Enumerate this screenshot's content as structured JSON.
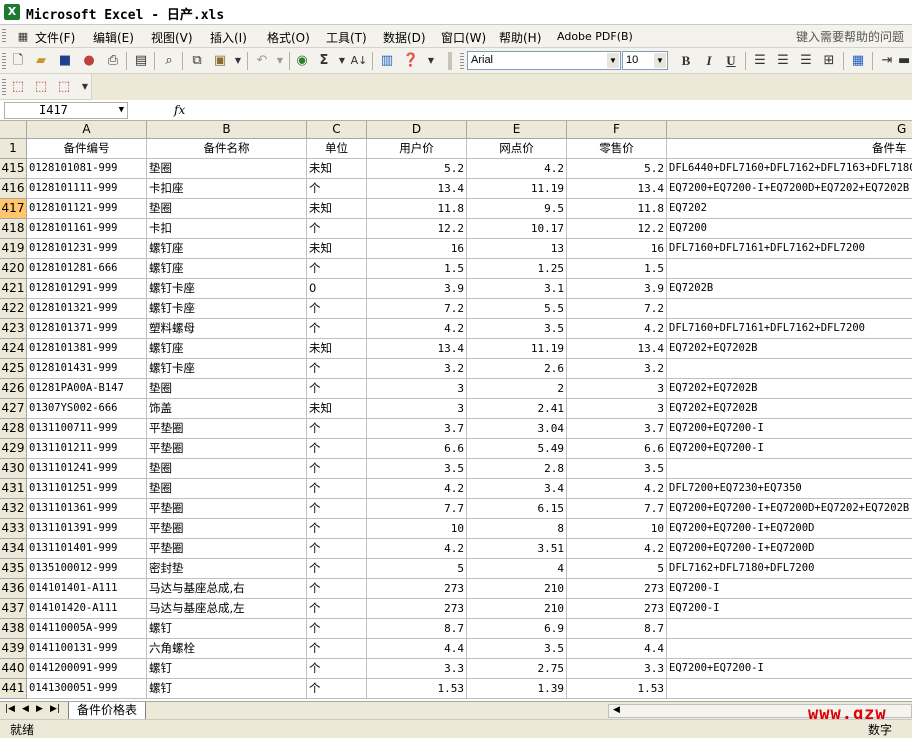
{
  "window": {
    "title": "Microsoft Excel - 日产.xls",
    "logo": "X"
  },
  "menu": {
    "items": [
      "文件(F)",
      "编辑(E)",
      "视图(V)",
      "插入(I)",
      "格式(O)",
      "工具(T)",
      "数据(D)",
      "窗口(W)",
      "帮助(H)",
      "Adobe PDF(B)"
    ],
    "help_placeholder": "键入需要帮助的问题"
  },
  "toolbar": {
    "font": "Arial",
    "font_size": "10",
    "undo_icon": "undo-icon",
    "bold": "B",
    "italic": "I",
    "underline": "U"
  },
  "formula_bar": {
    "name_box": "I417",
    "fx": "fx",
    "formula": ""
  },
  "colors": {
    "selected_row_header": "#ffc66b",
    "header_bg": "#ece9d8",
    "watermark": "#e00000"
  },
  "sheet": {
    "columns": [
      "A",
      "B",
      "C",
      "D",
      "E",
      "F",
      "G"
    ],
    "header_row_number": "1",
    "headers": [
      "备件编号",
      "备件名称",
      "单位",
      "用户价",
      "网点价",
      "零售价",
      "备件车"
    ],
    "selected_row": "417",
    "rows": [
      [
        "415",
        "0128101081-999",
        "垫圈",
        "未知",
        "5.2",
        "4.2",
        "5.2",
        "DFL6440+DFL7160+DFL7162+DFL7163+DFL7180+D"
      ],
      [
        "416",
        "0128101111-999",
        "卡扣座",
        "个",
        "13.4",
        "11.19",
        "13.4",
        "EQ7200+EQ7200-I+EQ7200D+EQ7202+EQ7202B"
      ],
      [
        "417",
        "0128101121-999",
        "垫圈",
        "未知",
        "11.8",
        "9.5",
        "11.8",
        "EQ7202"
      ],
      [
        "418",
        "0128101161-999",
        "卡扣",
        "个",
        "12.2",
        "10.17",
        "12.2",
        "EQ7200"
      ],
      [
        "419",
        "0128101231-999",
        "螺钉座",
        "未知",
        "16",
        "13",
        "16",
        "DFL7160+DFL7161+DFL7162+DFL7200"
      ],
      [
        "420",
        "0128101281-666",
        "螺钉座",
        "个",
        "1.5",
        "1.25",
        "1.5",
        ""
      ],
      [
        "421",
        "0128101291-999",
        "螺钉卡座",
        "0",
        "3.9",
        "3.1",
        "3.9",
        "EQ7202B"
      ],
      [
        "422",
        "0128101321-999",
        "螺钉卡座",
        "个",
        "7.2",
        "5.5",
        "7.2",
        ""
      ],
      [
        "423",
        "0128101371-999",
        "塑料螺母",
        "个",
        "4.2",
        "3.5",
        "4.2",
        "DFL7160+DFL7161+DFL7162+DFL7200"
      ],
      [
        "424",
        "0128101381-999",
        "螺钉座",
        "未知",
        "13.4",
        "11.19",
        "13.4",
        "EQ7202+EQ7202B"
      ],
      [
        "425",
        "0128101431-999",
        "螺钉卡座",
        "个",
        "3.2",
        "2.6",
        "3.2",
        ""
      ],
      [
        "426",
        "01281PA00A-B147",
        "垫圈",
        "个",
        "3",
        "2",
        "3",
        "EQ7202+EQ7202B"
      ],
      [
        "427",
        "01307YS002-666",
        "饰盖",
        "未知",
        "3",
        "2.41",
        "3",
        "EQ7202+EQ7202B"
      ],
      [
        "428",
        "0131100711-999",
        "平垫圈",
        "个",
        "3.7",
        "3.04",
        "3.7",
        "EQ7200+EQ7200-I"
      ],
      [
        "429",
        "0131101211-999",
        "平垫圈",
        "个",
        "6.6",
        "5.49",
        "6.6",
        "EQ7200+EQ7200-I"
      ],
      [
        "430",
        "0131101241-999",
        "垫圈",
        "个",
        "3.5",
        "2.8",
        "3.5",
        ""
      ],
      [
        "431",
        "0131101251-999",
        "垫圈",
        "个",
        "4.2",
        "3.4",
        "4.2",
        "DFL7200+EQ7230+EQ7350"
      ],
      [
        "432",
        "0131101361-999",
        "平垫圈",
        "个",
        "7.7",
        "6.15",
        "7.7",
        "EQ7200+EQ7200-I+EQ7200D+EQ7202+EQ7202B"
      ],
      [
        "433",
        "0131101391-999",
        "平垫圈",
        "个",
        "10",
        "8",
        "10",
        "EQ7200+EQ7200-I+EQ7200D"
      ],
      [
        "434",
        "0131101401-999",
        "平垫圈",
        "个",
        "4.2",
        "3.51",
        "4.2",
        "EQ7200+EQ7200-I+EQ7200D"
      ],
      [
        "435",
        "0135100012-999",
        "密封垫",
        "个",
        "5",
        "4",
        "5",
        "DFL7162+DFL7180+DFL7200"
      ],
      [
        "436",
        "014101401-A111",
        "马达与基座总成,右",
        "个",
        "273",
        "210",
        "273",
        "EQ7200-I"
      ],
      [
        "437",
        "014101420-A111",
        "马达与基座总成,左",
        "个",
        "273",
        "210",
        "273",
        "EQ7200-I"
      ],
      [
        "438",
        "014110005A-999",
        "螺钉",
        "个",
        "8.7",
        "6.9",
        "8.7",
        ""
      ],
      [
        "439",
        "0141100131-999",
        "六角螺栓",
        "个",
        "4.4",
        "3.5",
        "4.4",
        ""
      ],
      [
        "440",
        "0141200091-999",
        "螺钉",
        "个",
        "3.3",
        "2.75",
        "3.3",
        "EQ7200+EQ7200-I"
      ],
      [
        "441",
        "0141300051-999",
        "螺钉",
        "个",
        "1.53",
        "1.39",
        "1.53",
        ""
      ]
    ]
  },
  "sheet_tab": "备件价格表",
  "status": {
    "ready": "就绪",
    "mode": "数字"
  },
  "watermark": "www.gzw"
}
